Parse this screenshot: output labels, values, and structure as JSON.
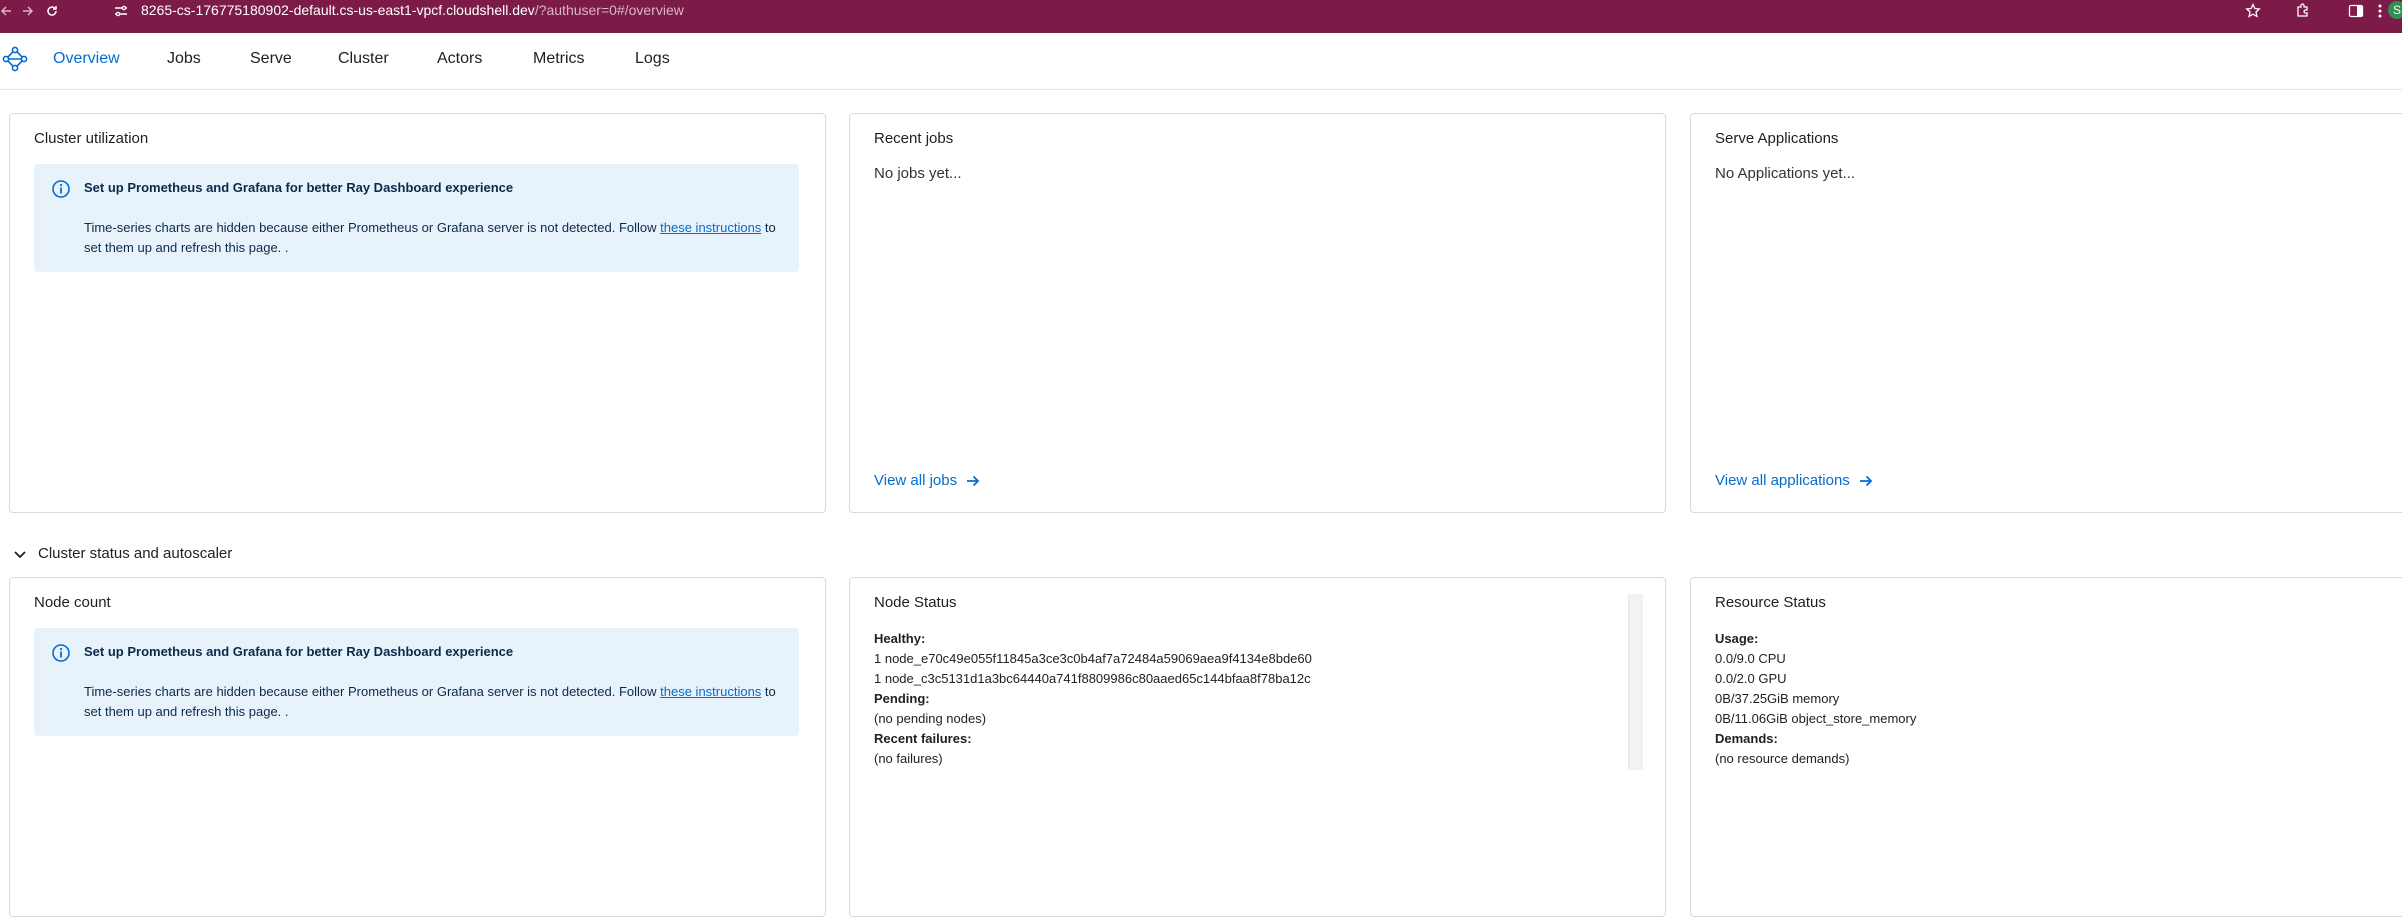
{
  "browser": {
    "url_host": "8265-cs-176775180902-default.cs-us-east1-vpcf.cloudshell.dev",
    "url_path": "/?authuser=0#/overview",
    "profile_initial": "S"
  },
  "nav": {
    "tabs": [
      "Overview",
      "Jobs",
      "Serve",
      "Cluster",
      "Actors",
      "Metrics",
      "Logs"
    ],
    "active": "Overview"
  },
  "cluster_utilization": {
    "title": "Cluster utilization",
    "info_title": "Set up Prometheus and Grafana for better Ray Dashboard experience",
    "info_text_1": "Time-series charts are hidden because either Prometheus or Grafana server is not detected. Follow ",
    "info_link": "these instructions",
    "info_text_2": " to set them up and refresh this page. ."
  },
  "recent_jobs": {
    "title": "Recent jobs",
    "empty": "No jobs yet...",
    "link": "View all jobs"
  },
  "serve_apps": {
    "title": "Serve Applications",
    "empty": "No Applications yet...",
    "link": "View all applications"
  },
  "section": {
    "title": "Cluster status and autoscaler"
  },
  "node_count": {
    "title": "Node count",
    "info_title": "Set up Prometheus and Grafana for better Ray Dashboard experience",
    "info_text_1": "Time-series charts are hidden because either Prometheus or Grafana server is not detected. Follow ",
    "info_link": "these instructions",
    "info_text_2": " to set them up and refresh this page. ."
  },
  "node_status": {
    "title": "Node Status",
    "healthy_label": "Healthy:",
    "healthy_nodes": [
      "1 node_e70c49e055f11845a3ce3c0b4af7a72484a59069aea9f4134e8bde60",
      "1 node_c3c5131d1a3bc64440a741f8809986c80aaed65c144bfaa8f78ba12c"
    ],
    "pending_label": "Pending:",
    "pending_value": "(no pending nodes)",
    "failures_label": "Recent failures:",
    "failures_value": "(no failures)"
  },
  "resource_status": {
    "title": "Resource Status",
    "usage_label": "Usage:",
    "usage": [
      "0.0/9.0 CPU",
      "0.0/2.0 GPU",
      "0B/37.25GiB memory",
      "0B/11.06GiB object_store_memory"
    ],
    "demands_label": "Demands:",
    "demands_value": "(no resource demands)"
  },
  "colors": {
    "accent": "#036dcf",
    "browser_bar": "#7c1b47",
    "info_bg": "#e8f2fb"
  }
}
